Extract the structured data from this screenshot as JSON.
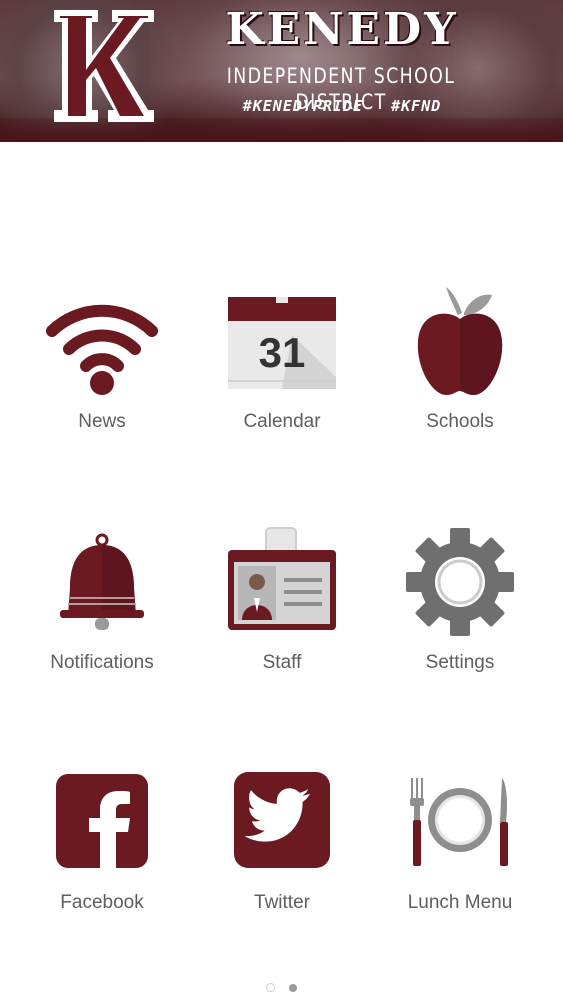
{
  "header": {
    "logo_letter": "K",
    "title": "KENEDY",
    "subtitle": "INDEPENDENT SCHOOL DISTRICT",
    "hashtags": "#KENEDYPRIDE #KFND"
  },
  "colors": {
    "maroon": "#6b1a22",
    "label_gray": "#5e5e5e",
    "gear_gray": "#6f6f6f"
  },
  "tiles": [
    {
      "label": "News",
      "icon": "wifi-icon"
    },
    {
      "label": "Calendar",
      "icon": "calendar-icon",
      "icon_text": "31"
    },
    {
      "label": "Schools",
      "icon": "apple-icon"
    },
    {
      "label": "Notifications",
      "icon": "bell-icon"
    },
    {
      "label": "Staff",
      "icon": "id-badge-icon"
    },
    {
      "label": "Settings",
      "icon": "gear-icon"
    },
    {
      "label": "Facebook",
      "icon": "facebook-icon"
    },
    {
      "label": "Twitter",
      "icon": "twitter-icon"
    },
    {
      "label": "Lunch Menu",
      "icon": "plate-utensils-icon"
    }
  ],
  "pager": {
    "pages": 2,
    "current": 2
  }
}
